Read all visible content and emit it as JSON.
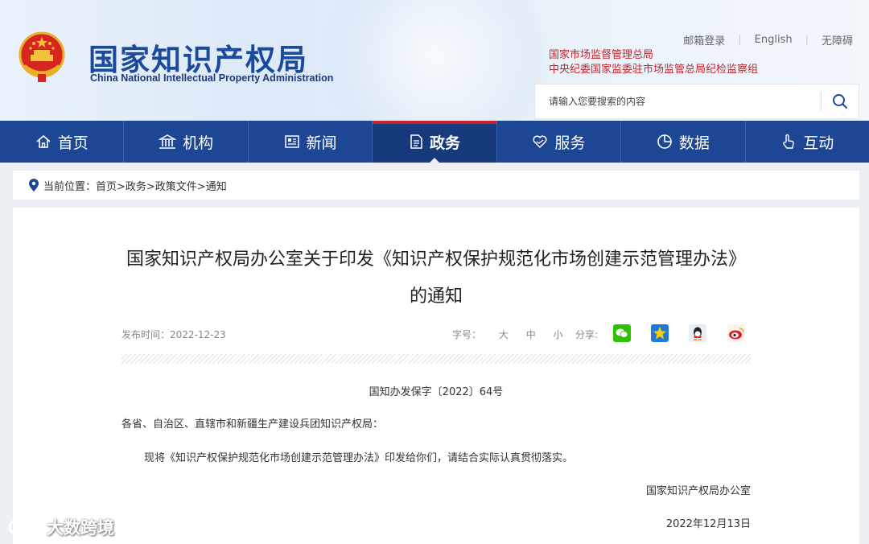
{
  "header": {
    "logo_cn": "国家知识产权局",
    "logo_en": "China National Intellectual Property Administration",
    "links": [
      "邮箱登录",
      "English",
      "无障碍"
    ],
    "agency_lines": [
      "国家市场监督管理总局",
      "中央纪委国家监委驻市场监管总局纪检监察组"
    ],
    "search_placeholder": "请输入您要搜索的内容"
  },
  "nav": {
    "items": [
      {
        "label": "首页",
        "icon": "home-icon"
      },
      {
        "label": "机构",
        "icon": "building-icon"
      },
      {
        "label": "新闻",
        "icon": "news-icon"
      },
      {
        "label": "政务",
        "icon": "document-icon",
        "active": true
      },
      {
        "label": "服务",
        "icon": "service-icon"
      },
      {
        "label": "数据",
        "icon": "pie-chart-icon"
      },
      {
        "label": "互动",
        "icon": "hand-icon"
      }
    ]
  },
  "breadcrumb": {
    "prefix": "当前位置：",
    "trail": "首页>政务>政策文件>通知"
  },
  "article": {
    "title": "国家知识产权局办公室关于印发《知识产权保护规范化市场创建示范管理办法》的通知",
    "date": "发布时间：2022-12-23",
    "font_label": "字号：",
    "font_sizes": [
      "大",
      "中",
      "小"
    ],
    "share_label": "分享:",
    "doc_number": "国知办发保字〔2022〕64号",
    "addressee": "各省、自治区、直辖市和新疆生产建设兵团知识产权局：",
    "body": "现将《知识产权保护规范化市场创建示范管理办法》印发给你们，请结合实际认真贯彻落实。",
    "signature": "国家知识产权局办公室",
    "sign_date": "2022年12月13日"
  },
  "watermark": "大数跨境",
  "colors": {
    "nav_bg": "#1d4794",
    "nav_active": "#163a7c",
    "accent_red": "#c0272d",
    "logo_blue": "#1a4a9c"
  }
}
